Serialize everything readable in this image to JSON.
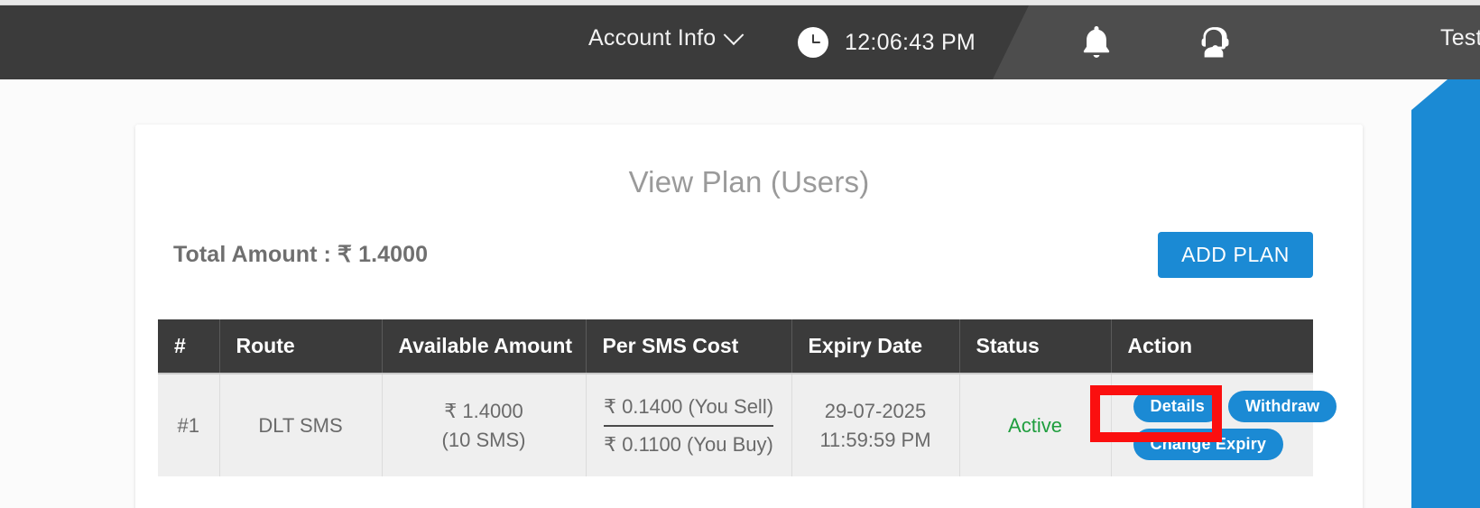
{
  "header": {
    "account_info_label": "Account Info",
    "chevron_icon": "chevron-down-icon",
    "clock_icon": "clock-icon",
    "time": "12:06:43 PM",
    "bell_icon": "bell-icon",
    "support_icon": "headset-support-icon",
    "user_name": "Test",
    "dark_bg": "#3b3b3b",
    "light_bg": "#4d4d4d"
  },
  "accent": {
    "blue": "#1b8ad4"
  },
  "card": {
    "title": "View Plan (Users)",
    "total_amount_label": "Total Amount : ₹ 1.4000",
    "add_plan_label": "ADD PLAN"
  },
  "table": {
    "columns": [
      "#",
      "Route",
      "Available Amount",
      "Per SMS Cost",
      "Expiry Date",
      "Status",
      "Action"
    ],
    "rows": [
      {
        "index": "#1",
        "route": "DLT SMS",
        "available_amount": "₹ 1.4000",
        "available_sms": "(10 SMS)",
        "cost_sell": "₹ 0.1400 (You Sell)",
        "cost_buy": "₹ 0.1100 (You Buy)",
        "expiry_date": "29-07-2025",
        "expiry_time": "11:59:59 PM",
        "status": "Active",
        "status_color": "#1f9e3e",
        "actions": [
          "Details",
          "Withdraw",
          "Change Expiry"
        ]
      }
    ]
  },
  "annotation": {
    "color": "#fb0f0f",
    "target": "Details"
  }
}
